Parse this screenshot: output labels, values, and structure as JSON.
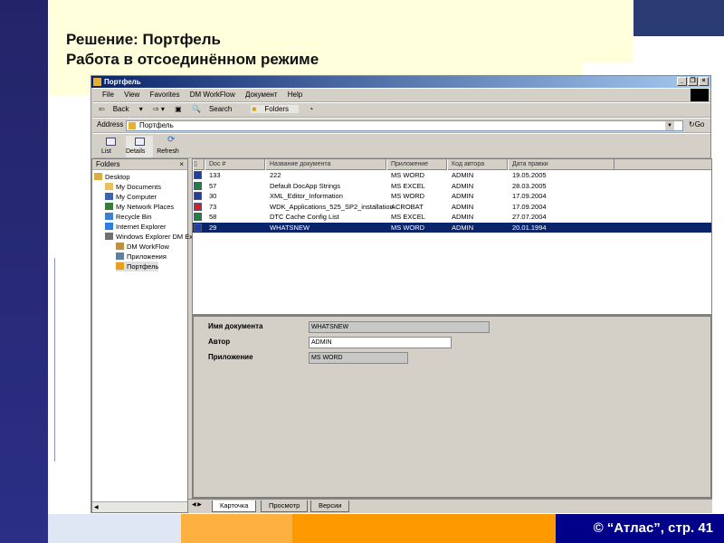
{
  "slide": {
    "title_line1": "Решение: Портфель",
    "title_line2": "Работа в отсоединённом режиме",
    "footer": "© “Атлас”, стр.  41"
  },
  "window": {
    "title": "Портфель",
    "menu": [
      "File",
      "View",
      "Favorites",
      "DM WorkFlow",
      "Документ",
      "Help"
    ],
    "toolbar": {
      "back": "Back",
      "search": "Search",
      "folders": "Folders"
    },
    "address": {
      "label": "Address",
      "value": "Портфель",
      "go": "Go"
    },
    "view_buttons": [
      "List",
      "Details",
      "Refresh"
    ],
    "folders": {
      "header": "Folders",
      "items": [
        {
          "label": "Desktop",
          "level": 0
        },
        {
          "label": "My Documents",
          "level": 1
        },
        {
          "label": "My Computer",
          "level": 1
        },
        {
          "label": "My Network Places",
          "level": 1
        },
        {
          "label": "Recycle Bin",
          "level": 1
        },
        {
          "label": "Internet Explorer",
          "level": 1
        },
        {
          "label": "Windows Explorer DM Ex",
          "level": 1
        },
        {
          "label": "DM WorkFlow",
          "level": 2
        },
        {
          "label": "Приложения",
          "level": 2
        },
        {
          "label": "Портфель",
          "level": 2
        }
      ]
    },
    "list": {
      "columns": [
        "Doc #",
        "Название документа",
        "Приложение",
        "Код автора",
        "Дата правки"
      ],
      "rows": [
        {
          "doc": "133",
          "name": "222",
          "app": "MS WORD",
          "author": "ADMIN",
          "date": "19.05.2005",
          "type": "word"
        },
        {
          "doc": "57",
          "name": "Default DocApp Strings",
          "app": "MS EXCEL",
          "author": "ADMIN",
          "date": "28.03.2005",
          "type": "excel"
        },
        {
          "doc": "30",
          "name": "XML_Editor_Information",
          "app": "MS WORD",
          "author": "ADMIN",
          "date": "17.09.2004",
          "type": "word"
        },
        {
          "doc": "73",
          "name": "WDK_Applications_525_SP2_installation",
          "app": "ACROBAT",
          "author": "ADMIN",
          "date": "17.09.2004",
          "type": "pdf"
        },
        {
          "doc": "58",
          "name": "DTC Cache Config List",
          "app": "MS EXCEL",
          "author": "ADMIN",
          "date": "27.07.2004",
          "type": "excel"
        },
        {
          "doc": "29",
          "name": "WHATSNEW",
          "app": "MS WORD",
          "author": "ADMIN",
          "date": "20.01.1994",
          "type": "word",
          "selected": true
        }
      ]
    },
    "detail": {
      "name_label": "Имя документа",
      "name_value": "WHATSNEW",
      "author_label": "Автор",
      "author_value": "ADMIN",
      "app_label": "Приложение",
      "app_value": "MS WORD"
    },
    "tabs": [
      "Карточка",
      "Просмотр",
      "Версии"
    ]
  },
  "colors": {
    "selection": "#0a246a",
    "footer_navy": "#000088",
    "orange": "#ff9900"
  }
}
